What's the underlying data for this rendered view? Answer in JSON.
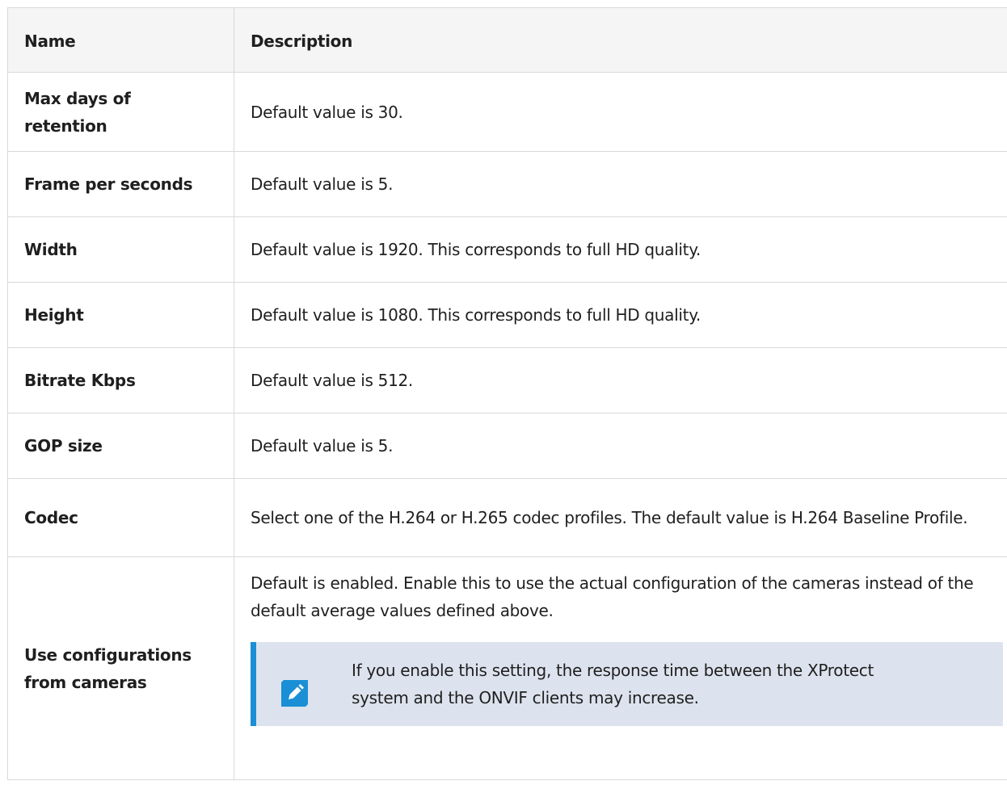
{
  "table": {
    "header": {
      "name": "Name",
      "description": "Description"
    },
    "rows": [
      {
        "name": "Max days of retention",
        "description": "Default value is 30."
      },
      {
        "name": "Frame per seconds",
        "description": "Default value is 5."
      },
      {
        "name": "Width",
        "description": "Default value is 1920. This corresponds to full HD quality."
      },
      {
        "name": "Height",
        "description": "Default value is 1080. This corresponds to full HD quality."
      },
      {
        "name": "Bitrate Kbps",
        "description": "Default value is 512."
      },
      {
        "name": "GOP size",
        "description": "Default value is 5."
      },
      {
        "name": "Codec",
        "description": "Select one of the H.264 or H.265 codec profiles. The default value is H.264 Baseline Profile."
      },
      {
        "name": "Use configurations from cameras",
        "description": "Default is enabled. Enable this to use the actual configuration of the cameras instead of the default average values defined above."
      }
    ]
  },
  "note": {
    "icon": "pencil-icon",
    "text": "If you enable this setting, the response time between the XProtect system and the ONVIF clients may increase."
  },
  "colors": {
    "header_bg": "#f5f5f5",
    "border": "#d9d9d9",
    "note_bg": "#dde3ee",
    "note_accent": "#1a8fd6"
  }
}
